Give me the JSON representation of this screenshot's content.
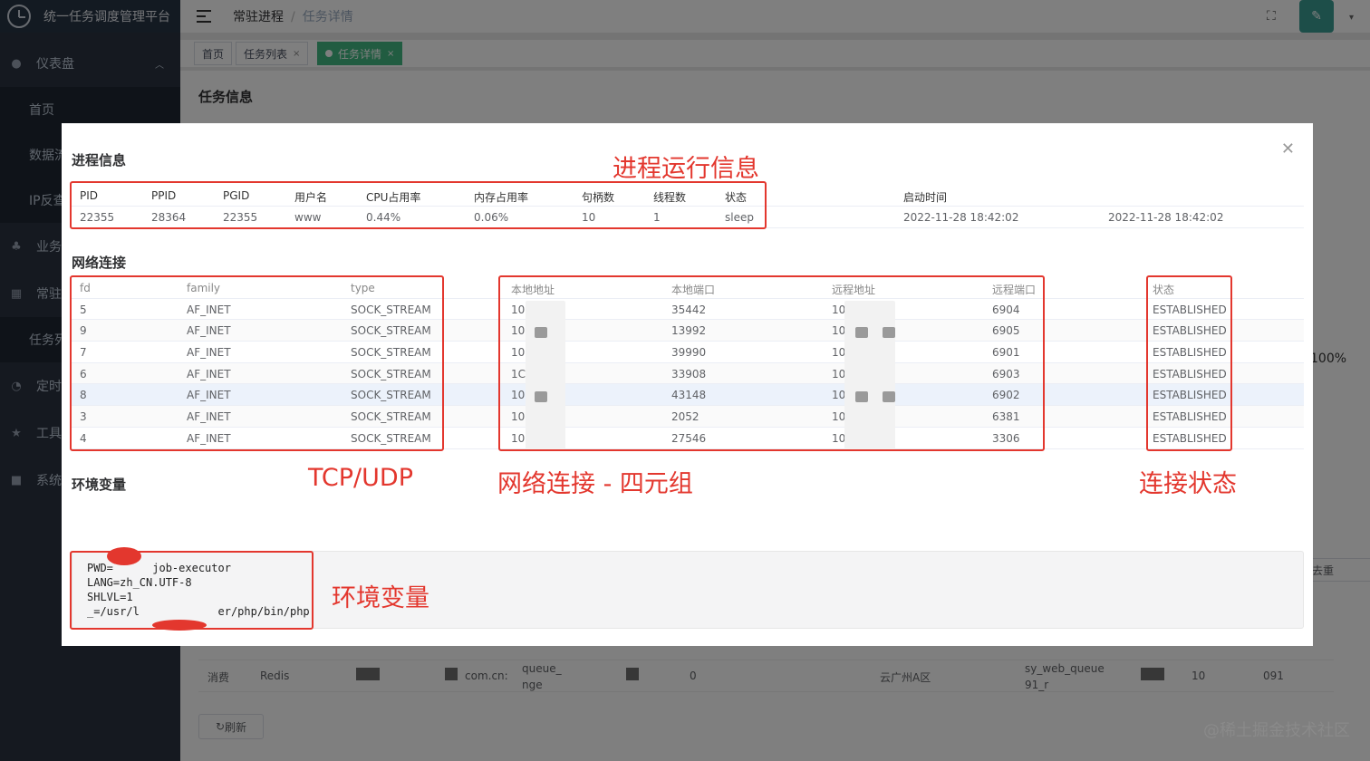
{
  "app_title": "统一任务调度管理平台",
  "sidebar": {
    "items": [
      {
        "icon": "dashboard-icon",
        "label": "仪表盘"
      },
      {
        "label": "首页"
      },
      {
        "label": "数据流"
      },
      {
        "label": "IP反查"
      },
      {
        "icon": "business-icon",
        "label": "业务"
      },
      {
        "icon": "grid-icon",
        "label": "常驻"
      },
      {
        "label": "任务列"
      },
      {
        "icon": "timer-icon",
        "label": "定时"
      },
      {
        "icon": "tools-icon",
        "label": "工具"
      },
      {
        "icon": "lock-icon",
        "label": "系统"
      }
    ]
  },
  "header": {
    "breadcrumb": [
      "常驻进程",
      "任务详情"
    ]
  },
  "tags": [
    {
      "label": "首页"
    },
    {
      "label": "任务列表"
    },
    {
      "label": "任务详情"
    }
  ],
  "main": {
    "title": "任务信息",
    "pct": "100%",
    "dedupe": "去重",
    "row": {
      "type": "消费",
      "kind": "Redis",
      "domain": "com.cn:",
      "queue": "queue_",
      "queue2": "nge",
      "zero": "0",
      "region": "云广州A区",
      "sqname": "sy_web_queue",
      "sq2": "91_r",
      "ip": "10",
      "port": "091"
    },
    "refresh": "刷新",
    "watermark": "@稀土掘金技术社区"
  },
  "modal": {
    "process": {
      "title": "进程信息",
      "headers": [
        "PID",
        "PPID",
        "PGID",
        "用户名",
        "CPU占用率",
        "内存占用率",
        "句柄数",
        "线程数",
        "状态",
        "启动时间"
      ],
      "row": [
        "22355",
        "28364",
        "22355",
        "www",
        "0.44%",
        "0.06%",
        "10",
        "1",
        "sleep",
        "2022-11-28 18:42:02",
        "2022-11-28 18:42:02"
      ]
    },
    "network": {
      "title": "网络连接",
      "headers": [
        "fd",
        "family",
        "type",
        "本地地址",
        "本地端口",
        "远程地址",
        "远程端口",
        "状态"
      ],
      "rows": [
        [
          "5",
          "AF_INET",
          "SOCK_STREAM",
          "10.",
          "35442",
          "10.",
          "6904",
          "ESTABLISHED"
        ],
        [
          "9",
          "AF_INET",
          "SOCK_STREAM",
          "10.",
          "13992",
          "10.",
          "6905",
          "ESTABLISHED"
        ],
        [
          "7",
          "AF_INET",
          "SOCK_STREAM",
          "10",
          "39990",
          "10.",
          "6901",
          "ESTABLISHED"
        ],
        [
          "6",
          "AF_INET",
          "SOCK_STREAM",
          "1C",
          "33908",
          "10.",
          "6903",
          "ESTABLISHED"
        ],
        [
          "8",
          "AF_INET",
          "SOCK_STREAM",
          "10.",
          "43148",
          "10.",
          "6902",
          "ESTABLISHED"
        ],
        [
          "3",
          "AF_INET",
          "SOCK_STREAM",
          "10.",
          "2052",
          "10.",
          "6381",
          "ESTABLISHED"
        ],
        [
          "4",
          "AF_INET",
          "SOCK_STREAM",
          "10",
          "27546",
          "10.",
          "3306",
          "ESTABLISHED"
        ]
      ]
    },
    "env": {
      "title": "环境变量",
      "lines": [
        "PWD=      job-executor",
        "LANG=zh_CN.UTF-8",
        "SHLVL=1",
        "_=/usr/l            er/php/bin/php"
      ]
    },
    "annotations": {
      "process": "进程运行信息",
      "tcp": "TCP/UDP",
      "tuple": "网络连接 - 四元组",
      "state": "连接状态",
      "env": "环境变量"
    }
  }
}
